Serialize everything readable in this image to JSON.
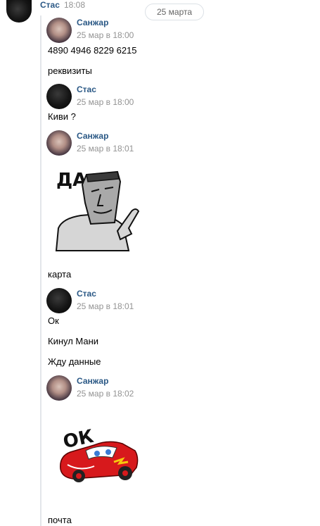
{
  "date_separator": "25 марта",
  "header": {
    "sender": "Стас",
    "time": "18:08"
  },
  "messages": [
    {
      "sender": "Санжар",
      "timestamp": "25 мар в 18:00",
      "lines": [
        "4890 4946 8229 6215",
        "реквизиты"
      ]
    },
    {
      "sender": "Стас",
      "timestamp": "25 мар в 18:00",
      "lines": [
        "Киви ?"
      ]
    },
    {
      "sender": "Санжар",
      "timestamp": "25 мар в 18:01",
      "sticker_text": "ДА",
      "lines": [
        "карта"
      ]
    },
    {
      "sender": "Стас",
      "timestamp": "25 мар в 18:01",
      "lines": [
        "Ок",
        "Кинул Мани",
        "Жду данные"
      ]
    },
    {
      "sender": "Санжар",
      "timestamp": "25 мар в 18:02",
      "sticker_text": "ОК",
      "lines": [
        "почта"
      ]
    }
  ],
  "colors": {
    "name": "#2a5885",
    "time": "#939393",
    "line": "#e3e6ea"
  },
  "icons": {
    "sticker_1": "moai-pointing-sticker",
    "sticker_2": "red-race-car-sticker"
  }
}
